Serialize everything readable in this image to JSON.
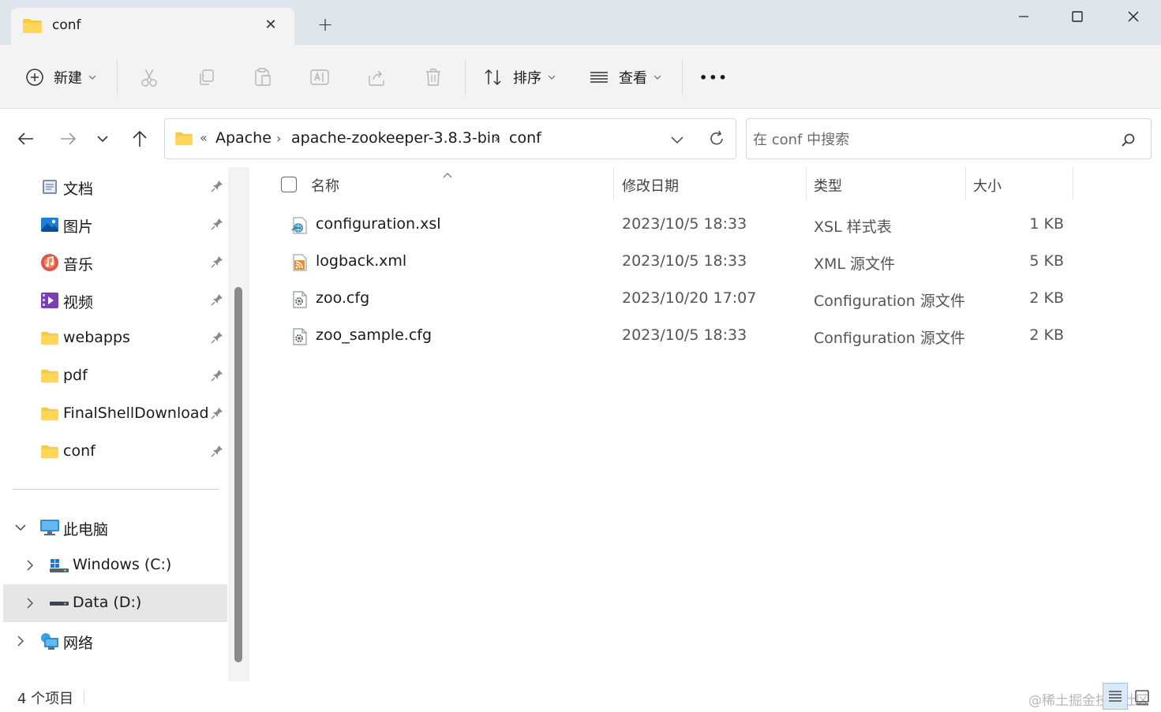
{
  "window": {
    "tab_title": "conf",
    "tab_close_glyph": "✕",
    "new_tab_glyph": "+"
  },
  "toolbar": {
    "new_label": "新建",
    "sort_label": "排序",
    "view_label": "查看",
    "more_glyph": "•••"
  },
  "address": {
    "overflow_glyph": "«",
    "separator_glyph": "›",
    "crumbs": [
      "Apache",
      "apache-zookeeper-3.8.3-bin",
      "conf"
    ]
  },
  "search": {
    "placeholder": "在 conf 中搜索"
  },
  "sidebar": {
    "quick_access": [
      {
        "label": "文档",
        "icon": "documents-icon"
      },
      {
        "label": "图片",
        "icon": "pictures-icon"
      },
      {
        "label": "音乐",
        "icon": "music-icon"
      },
      {
        "label": "视频",
        "icon": "videos-icon"
      },
      {
        "label": "webapps",
        "icon": "folder-icon"
      },
      {
        "label": "pdf",
        "icon": "folder-icon"
      },
      {
        "label": "FinalShellDownload",
        "icon": "folder-icon"
      },
      {
        "label": "conf",
        "icon": "folder-icon"
      }
    ],
    "this_pc": {
      "label": "此电脑",
      "icon": "computer-icon",
      "expanded": true
    },
    "drives": [
      {
        "label": "Windows (C:)",
        "icon": "windows-drive-icon",
        "selected": false
      },
      {
        "label": "Data (D:)",
        "icon": "drive-icon",
        "selected": true
      }
    ],
    "network": {
      "label": "网络",
      "icon": "network-icon"
    }
  },
  "filelist": {
    "columns": {
      "name": "名称",
      "modified": "修改日期",
      "type": "类型",
      "size": "大小"
    },
    "sorted_by": "name",
    "files": [
      {
        "name": "configuration.xsl",
        "modified": "2023/10/5 18:33",
        "type": "XSL 样式表",
        "size": "1 KB",
        "icon": "xsl-file-icon"
      },
      {
        "name": "logback.xml",
        "modified": "2023/10/5 18:33",
        "type": "XML 源文件",
        "size": "5 KB",
        "icon": "xml-file-icon"
      },
      {
        "name": "zoo.cfg",
        "modified": "2023/10/20 17:07",
        "type": "Configuration 源文件",
        "size": "2 KB",
        "icon": "config-file-icon"
      },
      {
        "name": "zoo_sample.cfg",
        "modified": "2023/10/5 18:33",
        "type": "Configuration 源文件",
        "size": "2 KB",
        "icon": "config-file-icon"
      }
    ]
  },
  "status": {
    "item_count": "4 个项目",
    "watermark": "@稀土掘金技术社区",
    "active_view": "details"
  },
  "colors": {
    "titlebar_bg": "#dfe5ec",
    "toolbar_bg": "#f3f3f3",
    "folder_yellow": "#f7c948",
    "selection_bg": "#e6e6e6",
    "accent_blue": "#0067c0"
  }
}
